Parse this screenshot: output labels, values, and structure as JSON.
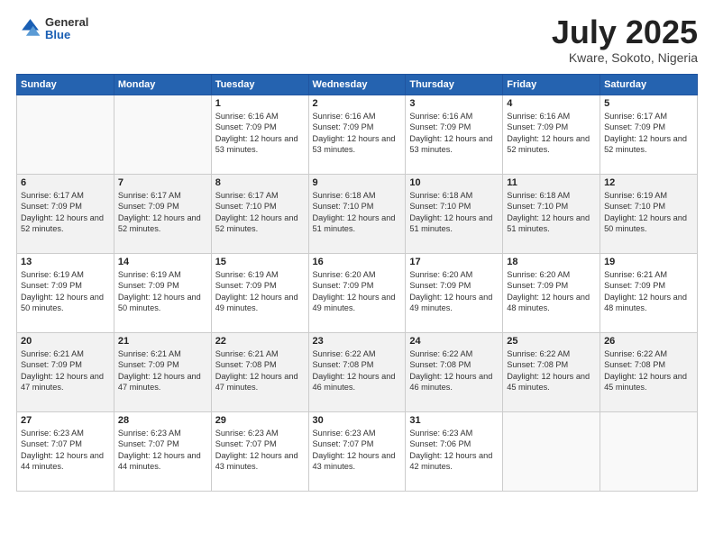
{
  "header": {
    "logo": {
      "general": "General",
      "blue": "Blue"
    },
    "title": "July 2025",
    "location": "Kware, Sokoto, Nigeria"
  },
  "weekdays": [
    "Sunday",
    "Monday",
    "Tuesday",
    "Wednesday",
    "Thursday",
    "Friday",
    "Saturday"
  ],
  "weeks": [
    {
      "shaded": false,
      "days": [
        {
          "date": "",
          "info": ""
        },
        {
          "date": "",
          "info": ""
        },
        {
          "date": "1",
          "info": "Sunrise: 6:16 AM\nSunset: 7:09 PM\nDaylight: 12 hours and 53 minutes."
        },
        {
          "date": "2",
          "info": "Sunrise: 6:16 AM\nSunset: 7:09 PM\nDaylight: 12 hours and 53 minutes."
        },
        {
          "date": "3",
          "info": "Sunrise: 6:16 AM\nSunset: 7:09 PM\nDaylight: 12 hours and 53 minutes."
        },
        {
          "date": "4",
          "info": "Sunrise: 6:16 AM\nSunset: 7:09 PM\nDaylight: 12 hours and 52 minutes."
        },
        {
          "date": "5",
          "info": "Sunrise: 6:17 AM\nSunset: 7:09 PM\nDaylight: 12 hours and 52 minutes."
        }
      ]
    },
    {
      "shaded": true,
      "days": [
        {
          "date": "6",
          "info": "Sunrise: 6:17 AM\nSunset: 7:09 PM\nDaylight: 12 hours and 52 minutes."
        },
        {
          "date": "7",
          "info": "Sunrise: 6:17 AM\nSunset: 7:09 PM\nDaylight: 12 hours and 52 minutes."
        },
        {
          "date": "8",
          "info": "Sunrise: 6:17 AM\nSunset: 7:10 PM\nDaylight: 12 hours and 52 minutes."
        },
        {
          "date": "9",
          "info": "Sunrise: 6:18 AM\nSunset: 7:10 PM\nDaylight: 12 hours and 51 minutes."
        },
        {
          "date": "10",
          "info": "Sunrise: 6:18 AM\nSunset: 7:10 PM\nDaylight: 12 hours and 51 minutes."
        },
        {
          "date": "11",
          "info": "Sunrise: 6:18 AM\nSunset: 7:10 PM\nDaylight: 12 hours and 51 minutes."
        },
        {
          "date": "12",
          "info": "Sunrise: 6:19 AM\nSunset: 7:10 PM\nDaylight: 12 hours and 50 minutes."
        }
      ]
    },
    {
      "shaded": false,
      "days": [
        {
          "date": "13",
          "info": "Sunrise: 6:19 AM\nSunset: 7:09 PM\nDaylight: 12 hours and 50 minutes."
        },
        {
          "date": "14",
          "info": "Sunrise: 6:19 AM\nSunset: 7:09 PM\nDaylight: 12 hours and 50 minutes."
        },
        {
          "date": "15",
          "info": "Sunrise: 6:19 AM\nSunset: 7:09 PM\nDaylight: 12 hours and 49 minutes."
        },
        {
          "date": "16",
          "info": "Sunrise: 6:20 AM\nSunset: 7:09 PM\nDaylight: 12 hours and 49 minutes."
        },
        {
          "date": "17",
          "info": "Sunrise: 6:20 AM\nSunset: 7:09 PM\nDaylight: 12 hours and 49 minutes."
        },
        {
          "date": "18",
          "info": "Sunrise: 6:20 AM\nSunset: 7:09 PM\nDaylight: 12 hours and 48 minutes."
        },
        {
          "date": "19",
          "info": "Sunrise: 6:21 AM\nSunset: 7:09 PM\nDaylight: 12 hours and 48 minutes."
        }
      ]
    },
    {
      "shaded": true,
      "days": [
        {
          "date": "20",
          "info": "Sunrise: 6:21 AM\nSunset: 7:09 PM\nDaylight: 12 hours and 47 minutes."
        },
        {
          "date": "21",
          "info": "Sunrise: 6:21 AM\nSunset: 7:09 PM\nDaylight: 12 hours and 47 minutes."
        },
        {
          "date": "22",
          "info": "Sunrise: 6:21 AM\nSunset: 7:08 PM\nDaylight: 12 hours and 47 minutes."
        },
        {
          "date": "23",
          "info": "Sunrise: 6:22 AM\nSunset: 7:08 PM\nDaylight: 12 hours and 46 minutes."
        },
        {
          "date": "24",
          "info": "Sunrise: 6:22 AM\nSunset: 7:08 PM\nDaylight: 12 hours and 46 minutes."
        },
        {
          "date": "25",
          "info": "Sunrise: 6:22 AM\nSunset: 7:08 PM\nDaylight: 12 hours and 45 minutes."
        },
        {
          "date": "26",
          "info": "Sunrise: 6:22 AM\nSunset: 7:08 PM\nDaylight: 12 hours and 45 minutes."
        }
      ]
    },
    {
      "shaded": false,
      "days": [
        {
          "date": "27",
          "info": "Sunrise: 6:23 AM\nSunset: 7:07 PM\nDaylight: 12 hours and 44 minutes."
        },
        {
          "date": "28",
          "info": "Sunrise: 6:23 AM\nSunset: 7:07 PM\nDaylight: 12 hours and 44 minutes."
        },
        {
          "date": "29",
          "info": "Sunrise: 6:23 AM\nSunset: 7:07 PM\nDaylight: 12 hours and 43 minutes."
        },
        {
          "date": "30",
          "info": "Sunrise: 6:23 AM\nSunset: 7:07 PM\nDaylight: 12 hours and 43 minutes."
        },
        {
          "date": "31",
          "info": "Sunrise: 6:23 AM\nSunset: 7:06 PM\nDaylight: 12 hours and 42 minutes."
        },
        {
          "date": "",
          "info": ""
        },
        {
          "date": "",
          "info": ""
        }
      ]
    }
  ]
}
